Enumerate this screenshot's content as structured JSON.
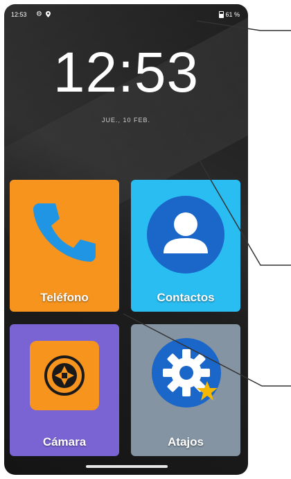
{
  "status_bar": {
    "time": "12:53",
    "notification_icons": [
      "settings-gear-icon",
      "location-pin-icon"
    ],
    "battery_percent": "61 %"
  },
  "lock": {
    "clock": "12:53",
    "date": "JUE., 10 FEB."
  },
  "apps": [
    {
      "label": "Teléfono",
      "color": "#f7941d",
      "icon": "phone-handset-icon"
    },
    {
      "label": "Contactos",
      "color": "#29bdf2",
      "icon": "contact-person-icon"
    },
    {
      "label": "Cámara",
      "color": "#7a64d4",
      "icon": "camera-shutter-icon"
    },
    {
      "label": "Atajos",
      "color": "#8494a3",
      "icon": "gear-star-icon"
    }
  ]
}
